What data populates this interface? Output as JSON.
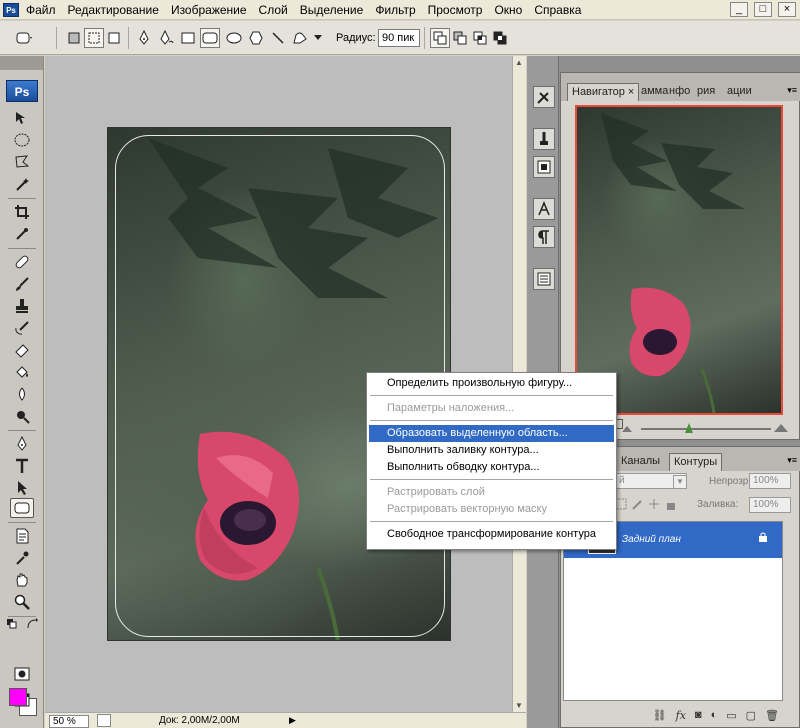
{
  "app": {
    "icon_text": "Ps"
  },
  "menubar": {
    "items": [
      "Файл",
      "Редактирование",
      "Изображение",
      "Слой",
      "Выделение",
      "Фильтр",
      "Просмотр",
      "Окно",
      "Справка"
    ],
    "window_buttons": [
      "_",
      "□",
      "×"
    ]
  },
  "options": {
    "radius_label": "Радиус:",
    "radius_value": "90 пик"
  },
  "toolbox": {
    "logo": "Ps"
  },
  "colors": {
    "foreground": "#ff00ff",
    "background": "#ffffff",
    "selection": "#316ac5",
    "navigator_frame": "#e84a3a"
  },
  "status": {
    "zoom": "50 %",
    "doc_info": "Док: 2,00M/2,00M"
  },
  "navigator": {
    "tabs": [
      "Навигатор ×",
      "амма",
      "нфо",
      "рия",
      "ации"
    ]
  },
  "layers": {
    "tabs": [
      "Каналы",
      "Контуры"
    ],
    "blend_mode": "й",
    "opacity_label": "Непрозр.:",
    "opacity_value": "100%",
    "fill_label": "Заливка:",
    "fill_value": "100%",
    "layer_name": "Задний план",
    "footer_icons": [
      "link-icon",
      "fx-icon",
      "mask-icon",
      "adjustment-icon",
      "folder-icon",
      "new-layer-icon",
      "trash-icon"
    ]
  },
  "context_menu": {
    "items": [
      {
        "label": "Определить произвольную фигуру...",
        "enabled": true
      },
      {
        "label": "Параметры наложения...",
        "enabled": false,
        "sep_before": true
      },
      {
        "label": "Образовать выделенную область...",
        "enabled": true,
        "highlighted": true,
        "sep_before": true
      },
      {
        "label": "Выполнить заливку контура...",
        "enabled": true
      },
      {
        "label": "Выполнить обводку контура...",
        "enabled": true
      },
      {
        "label": "Растрировать слой",
        "enabled": false,
        "sep_before": true
      },
      {
        "label": "Растрировать векторную маску",
        "enabled": false
      },
      {
        "label": "Свободное трансформирование контура",
        "enabled": true,
        "sep_before": true
      }
    ]
  }
}
